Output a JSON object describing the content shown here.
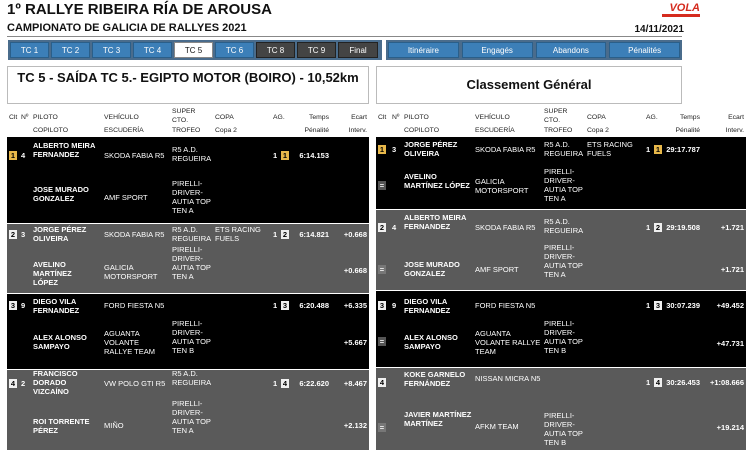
{
  "header": {
    "title": "1º RALLYE RIBEIRA RÍA DE AROUSA",
    "subtitle": "CAMPIONATO DE GALICIA DE RALLYES 2021",
    "date": "14/11/2021",
    "logo_text": "VOLA",
    "brand_color": "#d52b1e"
  },
  "tabs": [
    "TC 1",
    "TC 2",
    "TC 3",
    "TC 4",
    "TC 5",
    "TC 6",
    "TC 8",
    "TC 9",
    "Final"
  ],
  "active_tab": "TC 5",
  "nav_links": [
    "Itinéraire",
    "Engagés",
    "Abandons",
    "Pénalités"
  ],
  "left_title": "TC 5 - SAÍDA TC 5.- EGIPTO MOTOR (BOIRO) - 10,52km",
  "right_title": "Classement Général",
  "columns": {
    "clt": "Clt",
    "num": "Nº",
    "piloto": "PILOTO",
    "copiloto": "COPILOTO",
    "vehiculo": "VEHÍCULO",
    "escuderia": "ESCUDERÍA",
    "super_cto": "SUPER CTO.",
    "trofeo": "TROFEO",
    "copa": "COPA",
    "copa2": "Copa 2",
    "ag": "AG.",
    "temps": "Temps",
    "penalite": "Pénalité",
    "ecart": "Ecart",
    "interv": "Interv."
  },
  "left_rows": [
    {
      "pos": "1",
      "num": "4",
      "pilot": "ALBERTO MEIRA FERNANDEZ",
      "copilot": "JOSE MURADO GONZALEZ",
      "vehicle": "SKODA FABIA R5",
      "team": "AMF SPORT",
      "super": "R5 A.D. REGUEIRA",
      "trofeo": "PIRELLI-DRIVER-AUTIA TOP TEN A",
      "copa": "",
      "ag1": "1",
      "ag2": "1",
      "time": "6:14.153",
      "ecart": "",
      "interv": ""
    },
    {
      "pos": "2",
      "num": "3",
      "pilot": "JORGE PÉREZ OLIVEIRA",
      "copilot": "AVELINO MARTÍNEZ LÓPEZ",
      "vehicle": "SKODA FABIA R5",
      "team": "GALICIA MOTORSPORT",
      "super": "R5 A.D. REGUEIRA",
      "trofeo": "PIRELLI-DRIVER-AUTIA TOP TEN A",
      "copa": "ETS RACING FUELS",
      "ag1": "1",
      "ag2": "2",
      "time": "6:14.821",
      "ecart": "+0.668",
      "interv": "+0.668"
    },
    {
      "pos": "3",
      "num": "9",
      "pilot": "DIEGO VILA FERNANDEZ",
      "copilot": "ALEX ALONSO SAMPAYO",
      "vehicle": "FORD FIESTA N5",
      "team": "AGUANTA VOLANTE RALLYE TEAM",
      "super": "",
      "trofeo": "PIRELLI-DRIVER-AUTIA TOP TEN B",
      "copa": "",
      "ag1": "1",
      "ag2": "3",
      "time": "6:20.488",
      "ecart": "+6.335",
      "interv": "+5.667"
    },
    {
      "pos": "4",
      "num": "2",
      "pilot": "FRANCISCO DORADO VIZCAÍNO",
      "copilot": "ROI TORRENTE PÉREZ",
      "vehicle": "VW POLO GTI R5",
      "team": "MIÑO",
      "super": "R5 A.D. REGUEIRA",
      "trofeo": "PIRELLI-DRIVER-AUTIA TOP TEN A",
      "copa": "",
      "ag1": "1",
      "ag2": "4",
      "time": "6:22.620",
      "ecart": "+8.467",
      "interv": "+2.132"
    }
  ],
  "right_rows": [
    {
      "pos": "1",
      "num": "3",
      "pilot": "JORGE PÉREZ OLIVEIRA",
      "copilot": "AVELINO MARTÍNEZ LÓPEZ",
      "vehicle": "SKODA FABIA R5",
      "team": "GALICIA MOTORSPORT",
      "super": "R5 A.D. REGUEIRA",
      "trofeo": "PIRELLI-DRIVER-AUTIA TOP TEN A",
      "copa": "ETS RACING FUELS",
      "ag1": "1",
      "ag2": "1",
      "time": "29:17.787",
      "ecart": "",
      "interv": "",
      "eq": "="
    },
    {
      "pos": "2",
      "num": "4",
      "pilot": "ALBERTO MEIRA FERNANDEZ",
      "copilot": "JOSE MURADO GONZALEZ",
      "vehicle": "SKODA FABIA R5",
      "team": "AMF SPORT",
      "super": "R5 A.D. REGUEIRA",
      "trofeo": "PIRELLI-DRIVER-AUTIA TOP TEN A",
      "copa": "",
      "ag1": "1",
      "ag2": "2",
      "time": "29:19.508",
      "ecart": "+1.721",
      "interv": "+1.721",
      "eq": "="
    },
    {
      "pos": "3",
      "num": "9",
      "pilot": "DIEGO VILA FERNANDEZ",
      "copilot": "ALEX ALONSO SAMPAYO",
      "vehicle": "FORD FIESTA N5",
      "team": "AGUANTA VOLANTE RALLYE TEAM",
      "super": "",
      "trofeo": "PIRELLI-DRIVER-AUTIA TOP TEN B",
      "copa": "",
      "ag1": "1",
      "ag2": "3",
      "time": "30:07.239",
      "ecart": "+49.452",
      "interv": "+47.731",
      "eq": "="
    },
    {
      "pos": "4",
      "num": "",
      "pilot": "KOKE GARNELO FERNÁNDEZ",
      "copilot": "JAVIER MARTÍNEZ MARTÍNEZ",
      "vehicle": "NISSAN MICRA N5",
      "team": "AFKM TEAM",
      "super": "",
      "trofeo": "PIRELLI-DRIVER-AUTIA TOP TEN B",
      "copa": "",
      "ag1": "1",
      "ag2": "4",
      "time": "30:26.453",
      "ecart": "+1:08.666",
      "interv": "+19.214",
      "eq": "="
    }
  ]
}
